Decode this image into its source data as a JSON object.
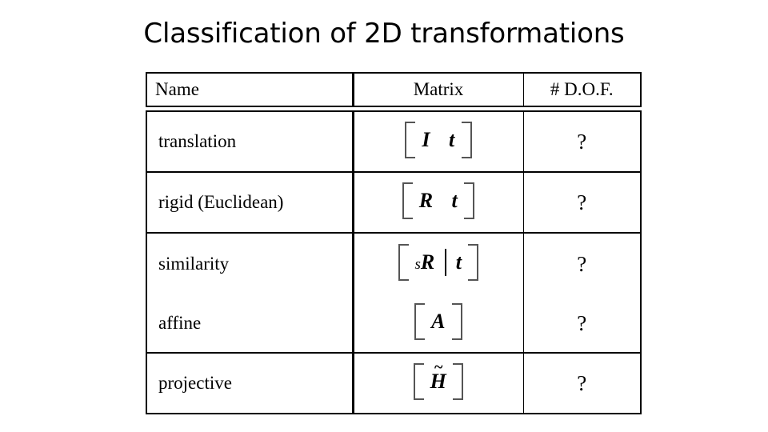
{
  "slide": {
    "title": "Classification of 2D transformations",
    "background_color": "#ffffff",
    "text_color": "#000000"
  },
  "table": {
    "headers": {
      "name": "Name",
      "matrix": "Matrix",
      "dof": "# D.O.F."
    },
    "rows": [
      {
        "name": "translation",
        "matrix_plain": "[ I  t ]",
        "matrix_symbols": {
          "first": "I",
          "second": "t",
          "scale": "",
          "separator": ""
        },
        "dof": "?"
      },
      {
        "name": "rigid (Euclidean)",
        "matrix_plain": "[ R  t ]",
        "matrix_symbols": {
          "first": "R",
          "second": "t",
          "scale": "",
          "separator": ""
        },
        "dof": "?"
      },
      {
        "name": "similarity",
        "matrix_plain": "[ sR | t ]",
        "matrix_symbols": {
          "first": "R",
          "second": "t",
          "scale": "s",
          "separator": "|"
        },
        "dof": "?"
      },
      {
        "name": "affine",
        "matrix_plain": "[ A ]",
        "matrix_symbols": {
          "first": "A",
          "second": "",
          "scale": "",
          "separator": ""
        },
        "dof": "?"
      },
      {
        "name": "projective",
        "matrix_plain": "[ H~ ]",
        "matrix_symbols": {
          "first": "H",
          "second": "",
          "scale": "",
          "separator": "",
          "accent": "~"
        },
        "dof": "?"
      }
    ]
  }
}
